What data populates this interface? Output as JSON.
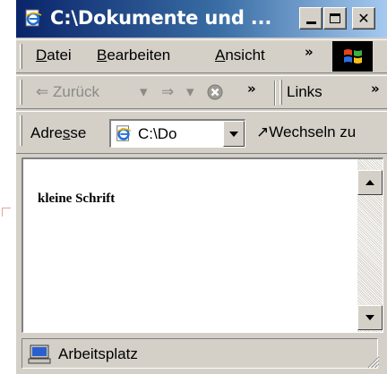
{
  "window": {
    "title": "C:\\Dokumente und ...",
    "buttons": {
      "minimize": "minimize",
      "maximize": "maximize",
      "close": "✕"
    }
  },
  "menu": {
    "items": [
      {
        "pre": "",
        "key": "D",
        "post": "atei"
      },
      {
        "pre": "",
        "key": "B",
        "post": "earbeiten"
      },
      {
        "pre": "",
        "key": "A",
        "post": "nsicht"
      }
    ],
    "overflow": "»"
  },
  "toolbar": {
    "back_label": "Zurück",
    "back_arrow": "⇐",
    "dropdown_glyph": "▾",
    "forward_arrow": "⇒",
    "overflow": "»",
    "links_label": "Links",
    "links_overflow": "»"
  },
  "address": {
    "label_pre": "Adre",
    "label_key": "s",
    "label_post": "se",
    "value": "C:\\Do",
    "go_label": "Wechseln zu",
    "go_glyph": "↗"
  },
  "content": {
    "text": "kleine Schrift"
  },
  "status": {
    "text": "Arbeitsplatz"
  },
  "colors": {
    "titlebar_start": "#0a246a",
    "titlebar_end": "#a6caf0",
    "chrome": "#d4d0c8"
  },
  "icons": {
    "title": "ie-document-icon",
    "address": "ie-document-icon",
    "status": "my-computer-icon",
    "brand": "windows-logo-icon"
  }
}
